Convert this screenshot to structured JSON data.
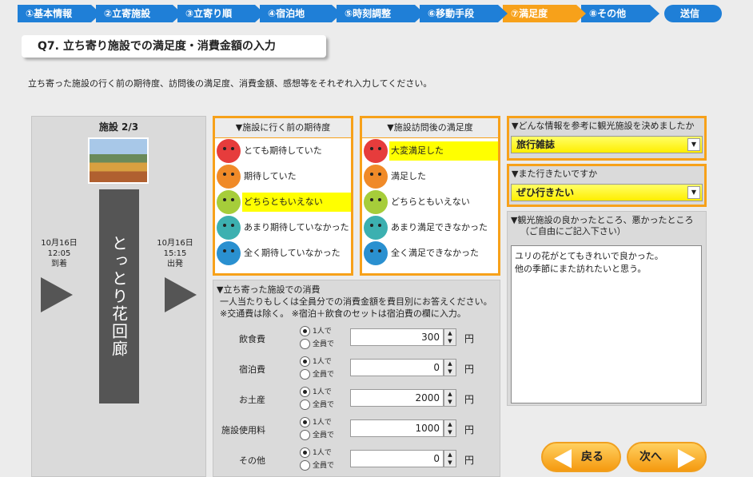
{
  "steps": [
    "①基本情報",
    "②立寄施設",
    "③立寄り順",
    "④宿泊地",
    "⑤時刻調整",
    "⑥移動手段",
    "⑦満足度",
    "⑧その他",
    "送信"
  ],
  "title": "Q7. 立ち寄り施設での満足度・消費金額の入力",
  "intro": "立ち寄った施設の行く前の期待度、訪問後の満足度、消費金額、感想等をそれぞれ入力してください。",
  "facility": {
    "counter": "施設 2/3",
    "name": "とっとり花回廊",
    "arrive": {
      "date": "10月16日",
      "time": "12:05",
      "label": "到着"
    },
    "depart": {
      "date": "10月16日",
      "time": "15:15",
      "label": "出発"
    }
  },
  "expectation": {
    "header": "▼施設に行く前の期待度",
    "options": [
      "とても期待していた",
      "期待していた",
      "どちらともいえない",
      "あまり期待していなかった",
      "全く期待していなかった"
    ],
    "selected": 2
  },
  "satisfaction": {
    "header": "▼施設訪問後の満足度",
    "options": [
      "大変満足した",
      "満足した",
      "どちらともいえない",
      "あまり満足できなかった",
      "全く満足できなかった"
    ],
    "selected": 0
  },
  "expense": {
    "title1": "▼立ち寄った施設での消費",
    "title2": "一人当たりもしくは全員分での消費金額を費目別にお答えください。",
    "title3": "※交通費は除く。 ※宿泊＋飲食のセットは宿泊費の欄に入力。",
    "per_person": "1人で",
    "all": "全員で",
    "yen": "円",
    "rows": [
      {
        "label": "飲食費",
        "value": "300"
      },
      {
        "label": "宿泊費",
        "value": "0"
      },
      {
        "label": "お土産",
        "value": "2000"
      },
      {
        "label": "施設使用料",
        "value": "1000"
      },
      {
        "label": "その他",
        "value": "0"
      }
    ]
  },
  "info": {
    "question": "▼どんな情報を参考に観光施設を決めましたか",
    "value": "旅行雑誌"
  },
  "revisit": {
    "question": "▼また行きたいですか",
    "value": "ぜひ行きたい"
  },
  "comment": {
    "question1": "▼観光施設の良かったところ、悪かったところ",
    "question2": "（ご自由にご記入下さい）",
    "text": "ユリの花がとてもきれいで良かった。\n他の季節にまた訪れたいと思う。"
  },
  "nav": {
    "back": "戻る",
    "next": "次へ"
  },
  "colors": {
    "step": "#1f7fd7",
    "active": "#f7a11a",
    "highlight": "#ffff00"
  }
}
